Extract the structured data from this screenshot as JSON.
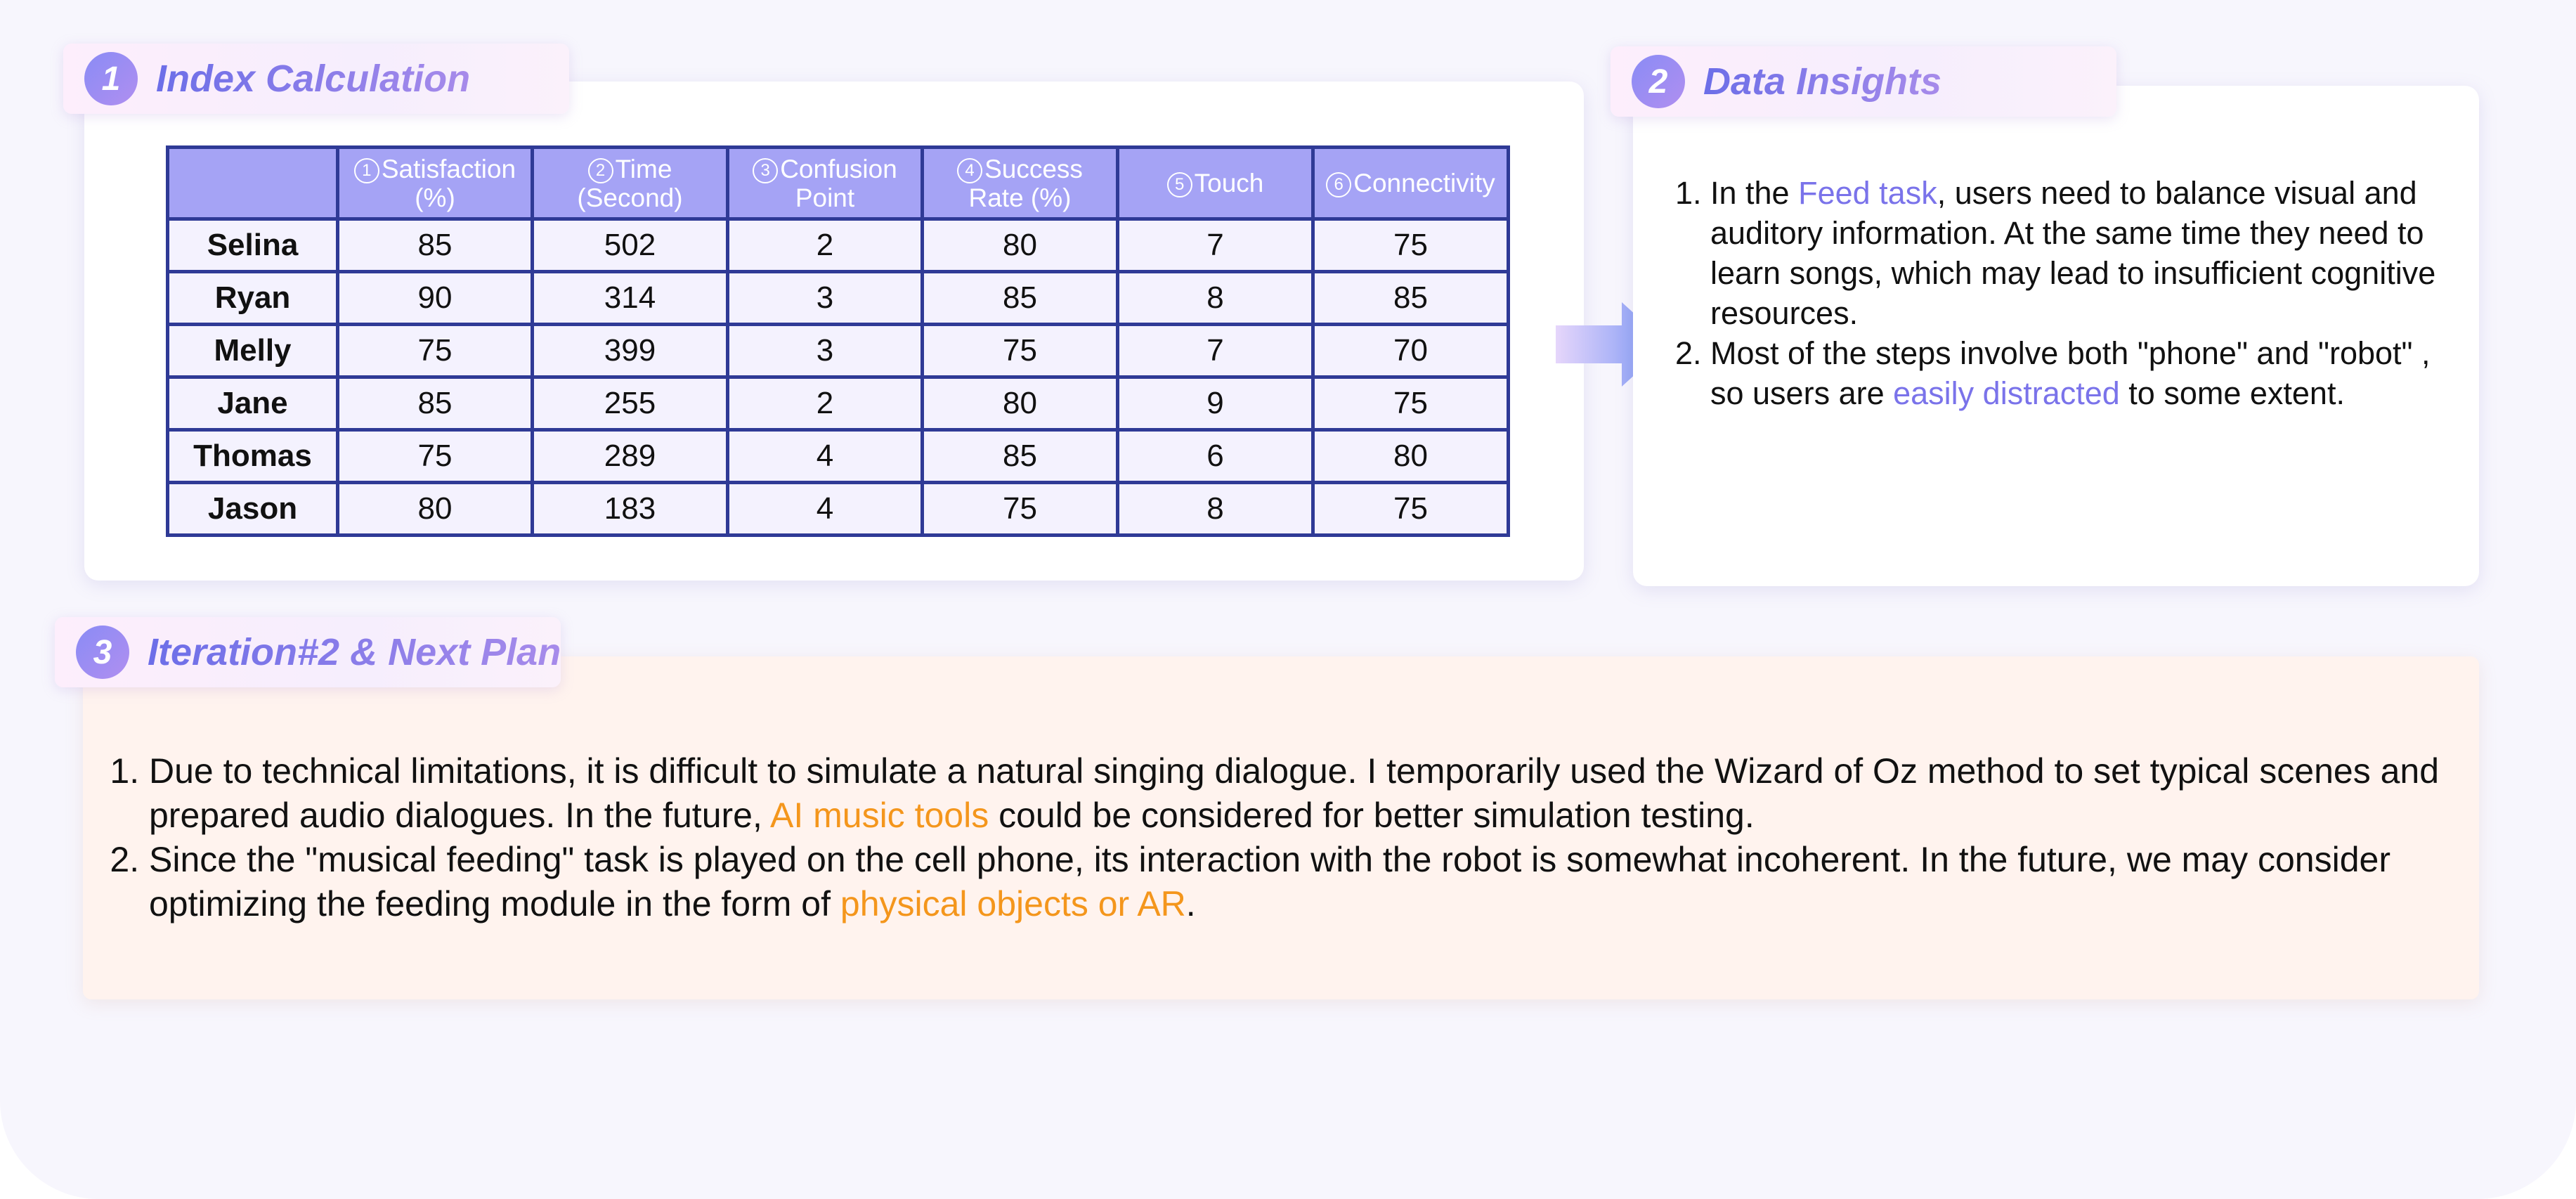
{
  "section1": {
    "number": "1",
    "title": "Index Calculation",
    "table": {
      "header_blank": "",
      "columns": [
        {
          "num": "1",
          "line1": "Satisfaction",
          "line2": "(%)"
        },
        {
          "num": "2",
          "line1": "Time",
          "line2": "(Second)"
        },
        {
          "num": "3",
          "line1": "Confusion",
          "line2": "Point"
        },
        {
          "num": "4",
          "line1": "Success",
          "line2": "Rate (%)"
        },
        {
          "num": "5",
          "line1": "Touch",
          "line2": ""
        },
        {
          "num": "6",
          "line1": "Connectivity",
          "line2": ""
        }
      ],
      "rows": [
        {
          "name": "Selina",
          "values": [
            "85",
            "502",
            "2",
            "80",
            "7",
            "75"
          ]
        },
        {
          "name": "Ryan",
          "values": [
            "90",
            "314",
            "3",
            "85",
            "8",
            "85"
          ]
        },
        {
          "name": "Melly",
          "values": [
            "75",
            "399",
            "3",
            "75",
            "7",
            "70"
          ]
        },
        {
          "name": "Jane",
          "values": [
            "85",
            "255",
            "2",
            "80",
            "9",
            "75"
          ]
        },
        {
          "name": "Thomas",
          "values": [
            "75",
            "289",
            "4",
            "85",
            "6",
            "80"
          ]
        },
        {
          "name": "Jason",
          "values": [
            "80",
            "183",
            "4",
            "75",
            "8",
            "75"
          ]
        }
      ]
    }
  },
  "section2": {
    "number": "2",
    "title": "Data Insights",
    "items": [
      {
        "pre": "In the ",
        "highlight": "Feed task",
        "post": ", users need to balance visual and auditory information. At the same time they need to learn songs, which may lead to insufficient cognitive resources."
      },
      {
        "pre": "Most of the steps involve both \"phone\" and \"robot\" , so users are ",
        "highlight": "easily distracted",
        "post": " to some extent."
      }
    ]
  },
  "section3": {
    "number": "3",
    "title": "Iteration#2 & Next Plan",
    "items": [
      {
        "pre": "Due to technical limitations, it is difficult to simulate a natural singing dialogue. I temporarily used the Wizard of Oz method to set typical scenes and prepared audio dialogues. In the future, ",
        "highlight": "AI music tools",
        "post": " could be considered for better simulation testing."
      },
      {
        "pre": "Since the \"musical feeding\" task is played on the cell phone, its interaction with the robot is somewhat incoherent. In the future, we may consider optimizing the feeding module in the form of ",
        "highlight": "physical objects or AR",
        "post": "."
      }
    ]
  },
  "colors": {
    "accent_purple": "#7a73ea",
    "accent_orange": "#f4961c",
    "table_header": "#a5a3f5",
    "table_border": "#2f3a96",
    "table_cell": "#f4f2fe"
  },
  "icons": {
    "connector_arrow": "arrow-right-icon"
  }
}
